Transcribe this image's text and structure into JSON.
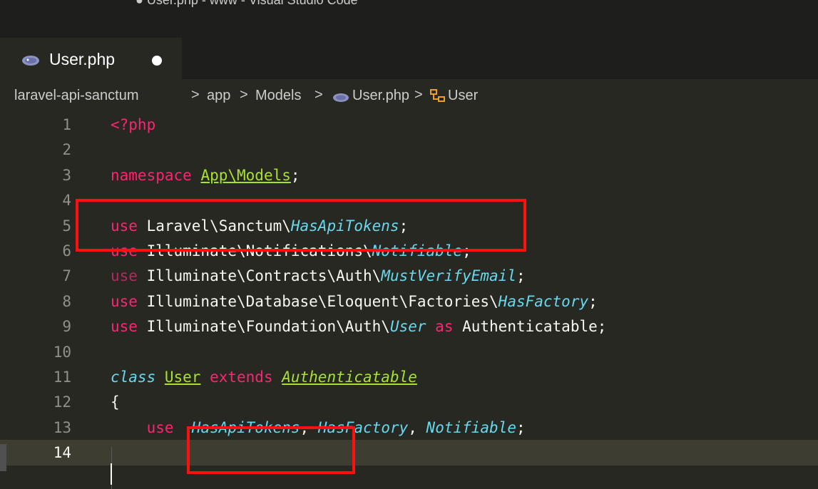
{
  "window": {
    "title": "● User.php - www - Visual Studio Code"
  },
  "tab": {
    "label": "User.php",
    "icon": "php-elephant-icon",
    "unsaved": true
  },
  "breadcrumb": {
    "items": [
      "laravel-api-sanctum",
      "app",
      "Models",
      "User.php",
      "User"
    ],
    "separator": ">"
  },
  "editor": {
    "current_line": 14,
    "lines": [
      {
        "n": "1",
        "tokens": [
          {
            "t": "<?php",
            "c": "kw"
          }
        ]
      },
      {
        "n": "2",
        "tokens": []
      },
      {
        "n": "3",
        "tokens": [
          {
            "t": "namespace ",
            "c": "kw"
          },
          {
            "t": "App\\Models",
            "c": "ns-und"
          },
          {
            "t": ";",
            "c": "white"
          }
        ]
      },
      {
        "n": "4",
        "tokens": []
      },
      {
        "n": "5",
        "tokens": [
          {
            "t": "use ",
            "c": "kw"
          },
          {
            "t": "Laravel\\Sanctum\\",
            "c": "white"
          },
          {
            "t": "HasApiTokens",
            "c": "cls-it"
          },
          {
            "t": ";",
            "c": "white"
          }
        ]
      },
      {
        "n": "6",
        "tokens": [
          {
            "t": "use ",
            "c": "kw"
          },
          {
            "t": "Illuminate\\Notifications\\",
            "c": "white"
          },
          {
            "t": "Notifiable",
            "c": "cls-it"
          },
          {
            "t": ";",
            "c": "white"
          }
        ]
      },
      {
        "n": "7",
        "tokens": [
          {
            "t": "use ",
            "c": "kw-dim"
          },
          {
            "t": "Illuminate\\Contracts\\Auth\\",
            "c": "white"
          },
          {
            "t": "MustVerifyEmail",
            "c": "cls-it"
          },
          {
            "t": ";",
            "c": "white"
          }
        ]
      },
      {
        "n": "8",
        "tokens": [
          {
            "t": "use ",
            "c": "kw"
          },
          {
            "t": "Illuminate\\Database\\Eloquent\\Factories\\",
            "c": "white"
          },
          {
            "t": "HasFactory",
            "c": "cls-it"
          },
          {
            "t": ";",
            "c": "white"
          }
        ]
      },
      {
        "n": "9",
        "tokens": [
          {
            "t": "use ",
            "c": "kw"
          },
          {
            "t": "Illuminate\\Foundation\\Auth\\",
            "c": "white"
          },
          {
            "t": "User",
            "c": "cls-it"
          },
          {
            "t": " as ",
            "c": "kw"
          },
          {
            "t": "Authenticatable",
            "c": "white"
          },
          {
            "t": ";",
            "c": "white"
          }
        ]
      },
      {
        "n": "10",
        "tokens": []
      },
      {
        "n": "11",
        "tokens": [
          {
            "t": "class ",
            "c": "cls-it"
          },
          {
            "t": "User",
            "c": "cls-und"
          },
          {
            "t": " extends ",
            "c": "kw"
          },
          {
            "t": "Authenticatable",
            "c": "cls-und-it"
          }
        ]
      },
      {
        "n": "12",
        "tokens": [
          {
            "t": "{",
            "c": "white"
          }
        ]
      },
      {
        "n": "13",
        "tokens": [
          {
            "t": "    use  ",
            "c": "kw"
          },
          {
            "t": "HasApiTokens",
            "c": "cls-it"
          },
          {
            "t": ", ",
            "c": "white"
          },
          {
            "t": "HasFactory",
            "c": "cls-it"
          },
          {
            "t": ", ",
            "c": "white"
          },
          {
            "t": "Notifiable",
            "c": "cls-it"
          },
          {
            "t": ";",
            "c": "white"
          }
        ]
      },
      {
        "n": "14",
        "tokens": []
      }
    ]
  },
  "colors": {
    "highlight_box": "#ff1010",
    "keyword": "#f92672",
    "class_name": "#66d9ef",
    "namespace": "#a6e22e"
  }
}
